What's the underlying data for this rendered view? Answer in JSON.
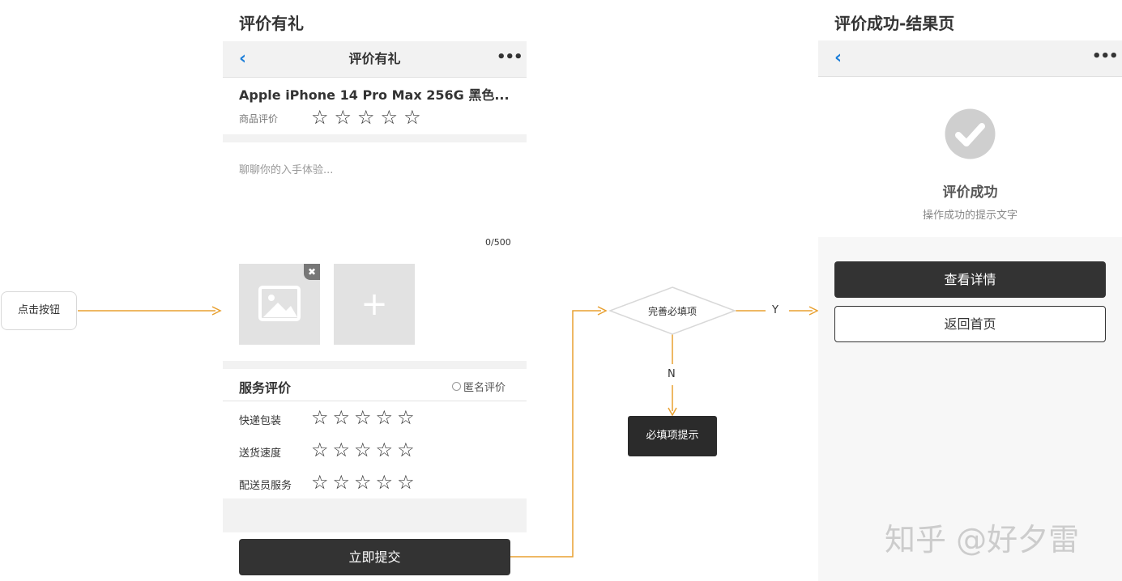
{
  "left_panel": {
    "page_title": "评价有礼",
    "nav_title": "评价有礼",
    "back_glyph": "‹",
    "more_glyph": "•••",
    "product_name": "Apple iPhone 14 Pro Max 256G 黑色...",
    "product_rating_label": "商品评价",
    "review_placeholder": "聊聊你的入手体验...",
    "char_count": "0/500",
    "upload_plus": "+",
    "service_title": "服务评价",
    "anonymous_label": "匿名评价",
    "service_rows": [
      {
        "label": "快递包装"
      },
      {
        "label": "送货速度"
      },
      {
        "label": "配送员服务"
      }
    ],
    "submit_label": "立即提交",
    "star_glyph": "☆"
  },
  "flow": {
    "start_node": "点击按钮",
    "decision": "完善必填项",
    "yes_label": "Y",
    "no_label": "N",
    "error_node": "必填项提示"
  },
  "right_panel": {
    "page_title": "评价成功-结果页",
    "back_glyph": "‹",
    "more_glyph": "•••",
    "success_title": "评价成功",
    "success_desc": "操作成功的提示文字",
    "view_details_label": "查看详情",
    "back_home_label": "返回首页"
  },
  "watermark": "知乎 @好夕雷",
  "colors": {
    "flow_line": "#e8a030",
    "nav_back": "#1e7fd9",
    "dark_button": "#333333",
    "placeholder_gray": "#e2e2e2"
  }
}
